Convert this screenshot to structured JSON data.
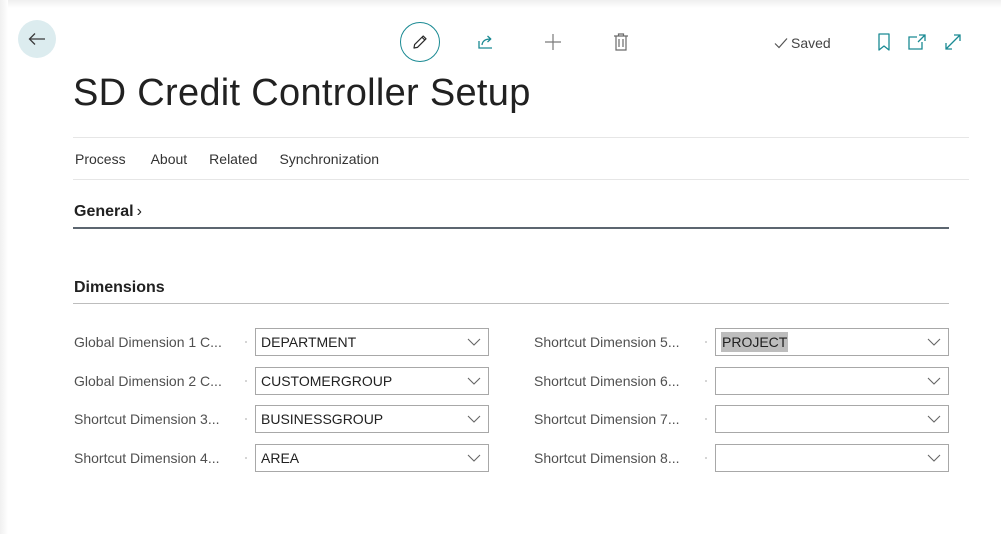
{
  "toolbar": {
    "back_icon": "arrow-left-icon",
    "edit_icon": "pencil-icon",
    "share_icon": "share-icon",
    "add_icon": "plus-icon",
    "delete_icon": "trash-icon",
    "saved_label": "Saved",
    "bookmark_icon": "bookmark-icon",
    "open_new_window_icon": "open-in-new-window-icon",
    "expand_icon": "expand-icon"
  },
  "page": {
    "title": "SD Credit Controller Setup"
  },
  "menu": {
    "items": [
      "Process",
      "About",
      "Related",
      "Synchronization"
    ]
  },
  "sections": {
    "general": {
      "label": "General",
      "chevron": "›"
    },
    "dimensions": {
      "label": "Dimensions"
    }
  },
  "dimensions": {
    "left": [
      {
        "label": "Global Dimension 1 C...",
        "value": "DEPARTMENT"
      },
      {
        "label": "Global Dimension 2 C...",
        "value": "CUSTOMERGROUP"
      },
      {
        "label": "Shortcut Dimension 3...",
        "value": "BUSINESSGROUP"
      },
      {
        "label": "Shortcut Dimension 4...",
        "value": "AREA"
      }
    ],
    "right": [
      {
        "label": "Shortcut Dimension 5...",
        "value": "PROJECT"
      },
      {
        "label": "Shortcut Dimension 6...",
        "value": ""
      },
      {
        "label": "Shortcut Dimension 7...",
        "value": ""
      },
      {
        "label": "Shortcut Dimension 8...",
        "value": ""
      }
    ]
  },
  "colors": {
    "accent": "#1a8a93",
    "back_button_bg": "#dcecef",
    "selected_text_bg": "#bdbdbd"
  }
}
